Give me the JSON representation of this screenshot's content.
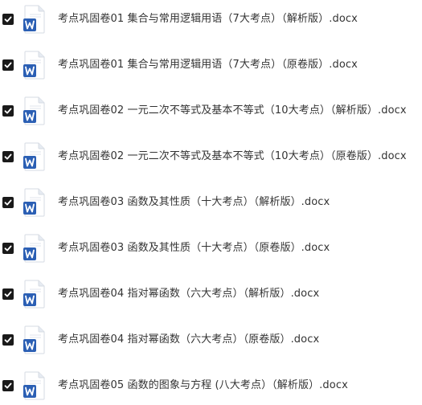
{
  "files": [
    {
      "name": "考点巩固卷01 集合与常用逻辑用语（7大考点）（解析版）.docx",
      "checked": true,
      "icon": "word-doc-icon"
    },
    {
      "name": "考点巩固卷01 集合与常用逻辑用语（7大考点）（原卷版）.docx",
      "checked": true,
      "icon": "word-doc-icon"
    },
    {
      "name": "考点巩固卷02 一元二次不等式及基本不等式（10大考点）（解析版）.docx",
      "checked": true,
      "icon": "word-doc-icon"
    },
    {
      "name": "考点巩固卷02 一元二次不等式及基本不等式（10大考点）（原卷版）.docx",
      "checked": true,
      "icon": "word-doc-icon"
    },
    {
      "name": "考点巩固卷03 函数及其性质（十大考点）（解析版）.docx",
      "checked": true,
      "icon": "word-doc-icon"
    },
    {
      "name": "考点巩固卷03 函数及其性质（十大考点）（原卷版）.docx",
      "checked": true,
      "icon": "word-doc-icon"
    },
    {
      "name": "考点巩固卷04 指对幂函数（六大考点）（解析版）.docx",
      "checked": true,
      "icon": "word-doc-icon"
    },
    {
      "name": "考点巩固卷04 指对幂函数（六大考点）（原卷版）.docx",
      "checked": true,
      "icon": "word-doc-icon"
    },
    {
      "name": "考点巩固卷05 函数的图象与方程 (八大考点）（解析版）.docx",
      "checked": true,
      "icon": "word-doc-icon"
    }
  ],
  "colors": {
    "checkbox_fill": "#1a1a1a",
    "word_blue": "#2b5fb4",
    "text": "#333333"
  }
}
